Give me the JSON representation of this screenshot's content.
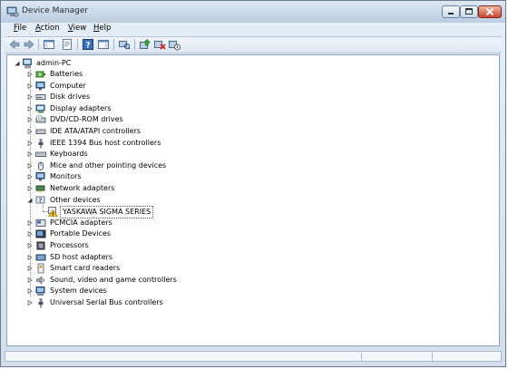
{
  "window": {
    "title": "Device Manager",
    "controls": {
      "minimize": "minimize",
      "maximize": "maximize",
      "close": "close"
    }
  },
  "menu": [
    {
      "label": "File",
      "mnemonic": "F"
    },
    {
      "label": "Action",
      "mnemonic": "A"
    },
    {
      "label": "View",
      "mnemonic": "V"
    },
    {
      "label": "Help",
      "mnemonic": "H"
    }
  ],
  "toolbar": {
    "icons": [
      "back-arrow-icon",
      "forward-arrow-icon",
      "show-hide-console-tree-icon",
      "properties-sheet-icon",
      "help-icon",
      "show-action-pane-icon",
      "scan-hardware-icon",
      "update-driver-icon",
      "uninstall-device-icon",
      "disable-device-icon"
    ]
  },
  "tree": {
    "root": {
      "label": "admin-PC",
      "expanded": true,
      "icon": "computer-icon"
    },
    "children": [
      {
        "label": "Batteries",
        "expanded": false,
        "icon": "battery-icon"
      },
      {
        "label": "Computer",
        "expanded": false,
        "icon": "monitor-icon"
      },
      {
        "label": "Disk drives",
        "expanded": false,
        "icon": "disk-drive-icon"
      },
      {
        "label": "Display adapters",
        "expanded": false,
        "icon": "display-adapter-icon"
      },
      {
        "label": "DVD/CD-ROM drives",
        "expanded": false,
        "icon": "dvd-drive-icon"
      },
      {
        "label": "IDE ATA/ATAPI controllers",
        "expanded": false,
        "icon": "ide-controller-icon"
      },
      {
        "label": "IEEE 1394 Bus host controllers",
        "expanded": false,
        "icon": "firewire-icon"
      },
      {
        "label": "Keyboards",
        "expanded": false,
        "icon": "keyboard-icon"
      },
      {
        "label": "Mice and other pointing devices",
        "expanded": false,
        "icon": "mouse-icon"
      },
      {
        "label": "Monitors",
        "expanded": false,
        "icon": "monitor-icon"
      },
      {
        "label": "Network adapters",
        "expanded": false,
        "icon": "network-adapter-icon"
      },
      {
        "label": "Other devices",
        "expanded": true,
        "icon": "unknown-device-icon",
        "children": [
          {
            "label": "YASKAWA SIGMA SERIES",
            "icon": "warning-device-icon",
            "selected": true
          }
        ]
      },
      {
        "label": "PCMCIA adapters",
        "expanded": false,
        "icon": "pcmcia-icon"
      },
      {
        "label": "Portable Devices",
        "expanded": false,
        "icon": "portable-device-icon"
      },
      {
        "label": "Processors",
        "expanded": false,
        "icon": "processor-icon"
      },
      {
        "label": "SD host adapters",
        "expanded": false,
        "icon": "sd-adapter-icon"
      },
      {
        "label": "Smart card readers",
        "expanded": false,
        "icon": "smart-card-icon"
      },
      {
        "label": "Sound, video and game controllers",
        "expanded": false,
        "icon": "sound-icon"
      },
      {
        "label": "System devices",
        "expanded": false,
        "icon": "system-device-icon"
      },
      {
        "label": "Universal Serial Bus controllers",
        "expanded": false,
        "icon": "usb-icon"
      }
    ]
  },
  "status": {
    "text": ""
  },
  "colors": {
    "title_gradient_top": "#dfe9f4",
    "window_frame": "#6b7c8e",
    "tree_background": "#ffffff",
    "warning": "#f2c200"
  }
}
